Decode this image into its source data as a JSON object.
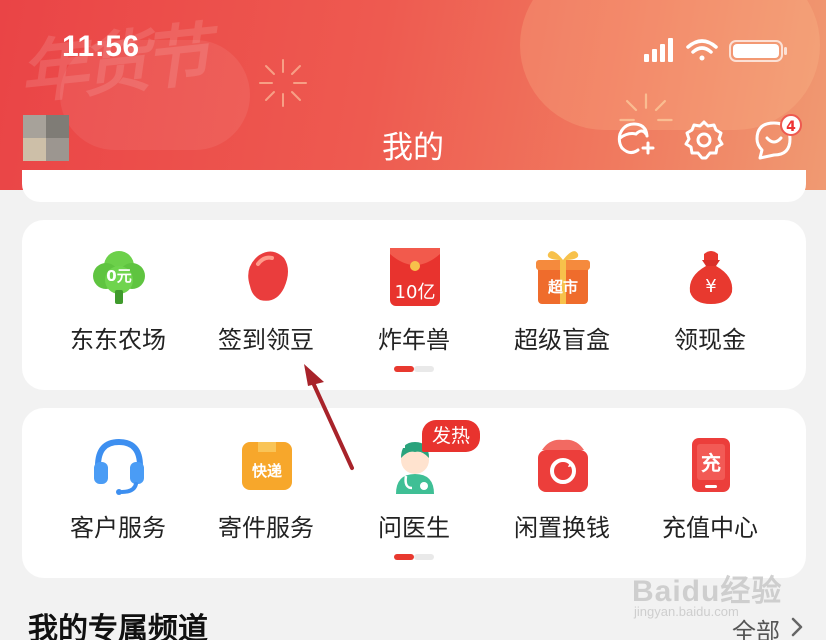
{
  "status_bar": {
    "time": "11:56",
    "icons": [
      "signal-icon",
      "wifi-icon",
      "battery-icon"
    ]
  },
  "header": {
    "title": "我的",
    "decoration_text": "年货节",
    "message_badge": "4",
    "icons": [
      "add-friend-icon",
      "settings-icon",
      "message-icon"
    ],
    "colors": {
      "start": "#ea4446",
      "end": "#f09a72"
    }
  },
  "services_row1": [
    {
      "label": "东东农场",
      "icon": "tree-icon",
      "icon_text": "0元"
    },
    {
      "label": "签到领豆",
      "icon": "bean-icon"
    },
    {
      "label": "炸年兽",
      "icon": "red-envelope-icon",
      "icon_text": "10亿"
    },
    {
      "label": "超级盲盒",
      "icon": "gift-box-icon",
      "icon_text": "超市"
    },
    {
      "label": "领现金",
      "icon": "money-bag-icon",
      "icon_text": "¥"
    }
  ],
  "services_row2": [
    {
      "label": "客户服务",
      "icon": "headset-icon"
    },
    {
      "label": "寄件服务",
      "icon": "package-icon",
      "icon_text": "快递"
    },
    {
      "label": "问医生",
      "icon": "doctor-icon",
      "tag": "发热"
    },
    {
      "label": "闲置换钱",
      "icon": "recycle-icon"
    },
    {
      "label": "充值中心",
      "icon": "phone-recharge-icon",
      "icon_text": "充"
    }
  ],
  "pager": {
    "active_index": 0,
    "pages": 2
  },
  "channel": {
    "title": "我的专属频道",
    "all_label": "全部"
  },
  "watermark": {
    "brand": "Baidu经验",
    "url": "jingyan.baidu.com"
  },
  "accent_color": "#e8392f"
}
